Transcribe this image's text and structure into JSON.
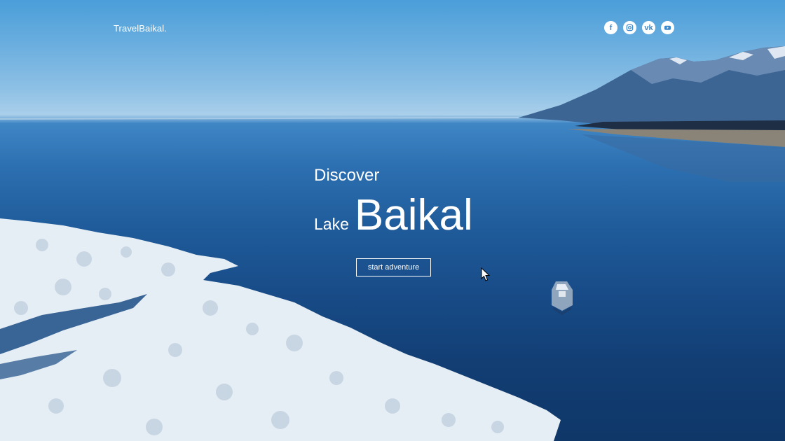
{
  "header": {
    "logo": "TravelBaikal."
  },
  "socials": [
    {
      "name": "facebook",
      "glyph": "f",
      "icon": "facebook-icon"
    },
    {
      "name": "instagram",
      "glyph": "",
      "icon": "instagram-icon"
    },
    {
      "name": "vk",
      "glyph": "vk",
      "icon": "vk-icon"
    },
    {
      "name": "youtube",
      "glyph": "",
      "icon": "youtube-icon"
    }
  ],
  "hero": {
    "discover": "Discover",
    "lake": "Lake",
    "baikal": "Baikal",
    "cta_label": "start adventure"
  },
  "colors": {
    "sky": "#4a9ed9",
    "water": "#184c88",
    "ice": "#dfe8f1",
    "text": "#ffffff"
  }
}
